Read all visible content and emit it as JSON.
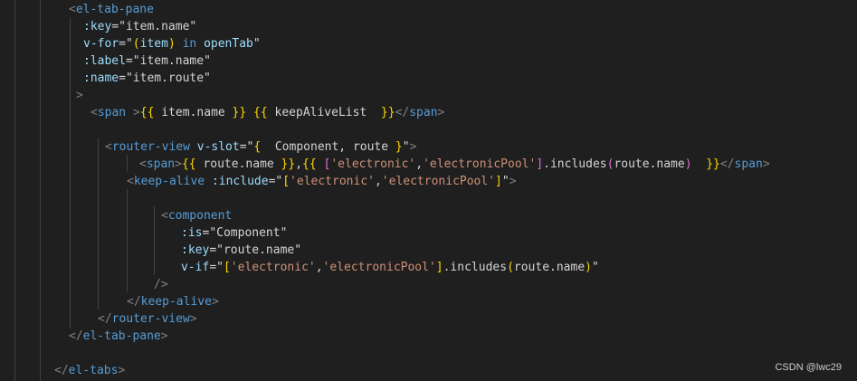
{
  "editor": {
    "lines": [
      {
        "indent": 76,
        "tokens": [
          {
            "t": "<",
            "c": "tk-punc"
          },
          {
            "t": "el-tab-pane",
            "c": "tk-tag"
          }
        ]
      },
      {
        "indent": 92,
        "tokens": [
          {
            "t": ":key",
            "c": "tk-attr"
          },
          {
            "t": "=",
            "c": "tk-text"
          },
          {
            "t": "\"item.name\"",
            "c": "tk-text"
          }
        ]
      },
      {
        "indent": 92,
        "tokens": [
          {
            "t": "v-for",
            "c": "tk-attr"
          },
          {
            "t": "=",
            "c": "tk-text"
          },
          {
            "t": "\"",
            "c": "tk-text"
          },
          {
            "t": "(",
            "c": "tk-b1"
          },
          {
            "t": "item",
            "c": "tk-attr"
          },
          {
            "t": ")",
            "c": "tk-b1"
          },
          {
            "t": " in ",
            "c": "tk-kw"
          },
          {
            "t": "openTab",
            "c": "tk-attr"
          },
          {
            "t": "\"",
            "c": "tk-text"
          }
        ]
      },
      {
        "indent": 92,
        "tokens": [
          {
            "t": ":label",
            "c": "tk-attr"
          },
          {
            "t": "=",
            "c": "tk-text"
          },
          {
            "t": "\"item.name\"",
            "c": "tk-text"
          }
        ]
      },
      {
        "indent": 92,
        "tokens": [
          {
            "t": ":name",
            "c": "tk-attr"
          },
          {
            "t": "=",
            "c": "tk-text"
          },
          {
            "t": "\"item.route\"",
            "c": "tk-text"
          }
        ]
      },
      {
        "indent": 84,
        "tokens": [
          {
            "t": ">",
            "c": "tk-punc"
          }
        ]
      },
      {
        "indent": 100,
        "tokens": [
          {
            "t": "<",
            "c": "tk-punc"
          },
          {
            "t": "span",
            "c": "tk-tag"
          },
          {
            "t": " >",
            "c": "tk-punc"
          },
          {
            "t": "{{",
            "c": "tk-b1"
          },
          {
            "t": " item.name ",
            "c": "tk-text"
          },
          {
            "t": "}}",
            "c": "tk-b1"
          },
          {
            "t": " ",
            "c": "tk-text"
          },
          {
            "t": "{{",
            "c": "tk-b1"
          },
          {
            "t": " keepAliveList  ",
            "c": "tk-text"
          },
          {
            "t": "}}",
            "c": "tk-b1"
          },
          {
            "t": "</",
            "c": "tk-punc"
          },
          {
            "t": "span",
            "c": "tk-tag"
          },
          {
            "t": ">",
            "c": "tk-punc"
          }
        ]
      },
      {
        "indent": 0,
        "tokens": []
      },
      {
        "indent": 116,
        "tokens": [
          {
            "t": "<",
            "c": "tk-punc"
          },
          {
            "t": "router-view",
            "c": "tk-tag"
          },
          {
            "t": " ",
            "c": "tk-text"
          },
          {
            "t": "v-slot",
            "c": "tk-attr"
          },
          {
            "t": "=",
            "c": "tk-text"
          },
          {
            "t": "\"",
            "c": "tk-text"
          },
          {
            "t": "{",
            "c": "tk-b1"
          },
          {
            "t": "  Component, route ",
            "c": "tk-text"
          },
          {
            "t": "}",
            "c": "tk-b1"
          },
          {
            "t": "\"",
            "c": "tk-text"
          },
          {
            "t": ">",
            "c": "tk-punc"
          }
        ]
      },
      {
        "indent": 154,
        "tokens": [
          {
            "t": "<",
            "c": "tk-punc"
          },
          {
            "t": "span",
            "c": "tk-tag"
          },
          {
            "t": ">",
            "c": "tk-punc"
          },
          {
            "t": "{{",
            "c": "tk-b1"
          },
          {
            "t": " route.name ",
            "c": "tk-text"
          },
          {
            "t": "}}",
            "c": "tk-b1"
          },
          {
            "t": ",",
            "c": "tk-text"
          },
          {
            "t": "{{",
            "c": "tk-b1"
          },
          {
            "t": " ",
            "c": "tk-text"
          },
          {
            "t": "[",
            "c": "tk-b2"
          },
          {
            "t": "'electronic'",
            "c": "tk-str"
          },
          {
            "t": ",",
            "c": "tk-text"
          },
          {
            "t": "'electronicPool'",
            "c": "tk-str"
          },
          {
            "t": "]",
            "c": "tk-b2"
          },
          {
            "t": ".includes",
            "c": "tk-text"
          },
          {
            "t": "(",
            "c": "tk-b2"
          },
          {
            "t": "route.name",
            "c": "tk-text"
          },
          {
            "t": ")",
            "c": "tk-b2"
          },
          {
            "t": "  ",
            "c": "tk-text"
          },
          {
            "t": "}}",
            "c": "tk-b1"
          },
          {
            "t": "</",
            "c": "tk-punc"
          },
          {
            "t": "span",
            "c": "tk-tag"
          },
          {
            "t": ">",
            "c": "tk-punc"
          }
        ]
      },
      {
        "indent": 140,
        "tokens": [
          {
            "t": "<",
            "c": "tk-punc"
          },
          {
            "t": "keep-alive",
            "c": "tk-tag"
          },
          {
            "t": " ",
            "c": "tk-text"
          },
          {
            "t": ":include",
            "c": "tk-attr"
          },
          {
            "t": "=",
            "c": "tk-text"
          },
          {
            "t": "\"",
            "c": "tk-text"
          },
          {
            "t": "[",
            "c": "tk-b1"
          },
          {
            "t": "'electronic'",
            "c": "tk-str"
          },
          {
            "t": ",",
            "c": "tk-text"
          },
          {
            "t": "'electronicPool'",
            "c": "tk-str"
          },
          {
            "t": "]",
            "c": "tk-b1"
          },
          {
            "t": "\"",
            "c": "tk-text"
          },
          {
            "t": ">",
            "c": "tk-punc"
          }
        ]
      },
      {
        "indent": 0,
        "tokens": []
      },
      {
        "indent": 178,
        "tokens": [
          {
            "t": "<",
            "c": "tk-punc"
          },
          {
            "t": "component",
            "c": "tk-tag"
          }
        ]
      },
      {
        "indent": 200,
        "tokens": [
          {
            "t": ":is",
            "c": "tk-attr"
          },
          {
            "t": "=",
            "c": "tk-text"
          },
          {
            "t": "\"Component\"",
            "c": "tk-text"
          }
        ]
      },
      {
        "indent": 200,
        "tokens": [
          {
            "t": ":key",
            "c": "tk-attr"
          },
          {
            "t": "=",
            "c": "tk-text"
          },
          {
            "t": "\"route.name\"",
            "c": "tk-text"
          }
        ]
      },
      {
        "indent": 200,
        "tokens": [
          {
            "t": "v-if",
            "c": "tk-attr"
          },
          {
            "t": "=",
            "c": "tk-text"
          },
          {
            "t": "\"",
            "c": "tk-text"
          },
          {
            "t": "[",
            "c": "tk-b1"
          },
          {
            "t": "'electronic'",
            "c": "tk-str"
          },
          {
            "t": ",",
            "c": "tk-text"
          },
          {
            "t": "'electronicPool'",
            "c": "tk-str"
          },
          {
            "t": "]",
            "c": "tk-b1"
          },
          {
            "t": ".includes",
            "c": "tk-text"
          },
          {
            "t": "(",
            "c": "tk-b1"
          },
          {
            "t": "route.name",
            "c": "tk-text"
          },
          {
            "t": ")",
            "c": "tk-b1"
          },
          {
            "t": "\"",
            "c": "tk-text"
          }
        ]
      },
      {
        "indent": 170,
        "tokens": [
          {
            "t": "/>",
            "c": "tk-punc"
          }
        ]
      },
      {
        "indent": 140,
        "tokens": [
          {
            "t": "</",
            "c": "tk-punc"
          },
          {
            "t": "keep-alive",
            "c": "tk-tag"
          },
          {
            "t": ">",
            "c": "tk-punc"
          }
        ]
      },
      {
        "indent": 108,
        "tokens": [
          {
            "t": "</",
            "c": "tk-punc"
          },
          {
            "t": "router-view",
            "c": "tk-tag"
          },
          {
            "t": ">",
            "c": "tk-punc"
          }
        ]
      },
      {
        "indent": 76,
        "tokens": [
          {
            "t": "</",
            "c": "tk-punc"
          },
          {
            "t": "el-tab-pane",
            "c": "tk-tag"
          },
          {
            "t": ">",
            "c": "tk-punc"
          }
        ]
      },
      {
        "indent": 0,
        "tokens": []
      },
      {
        "indent": 60,
        "tokens": [
          {
            "t": "</",
            "c": "tk-punc"
          },
          {
            "t": "el-tabs",
            "c": "tk-tag"
          },
          {
            "t": ">",
            "c": "tk-punc"
          }
        ]
      }
    ]
  },
  "watermark": {
    "text": "CSDN @lwc29"
  }
}
